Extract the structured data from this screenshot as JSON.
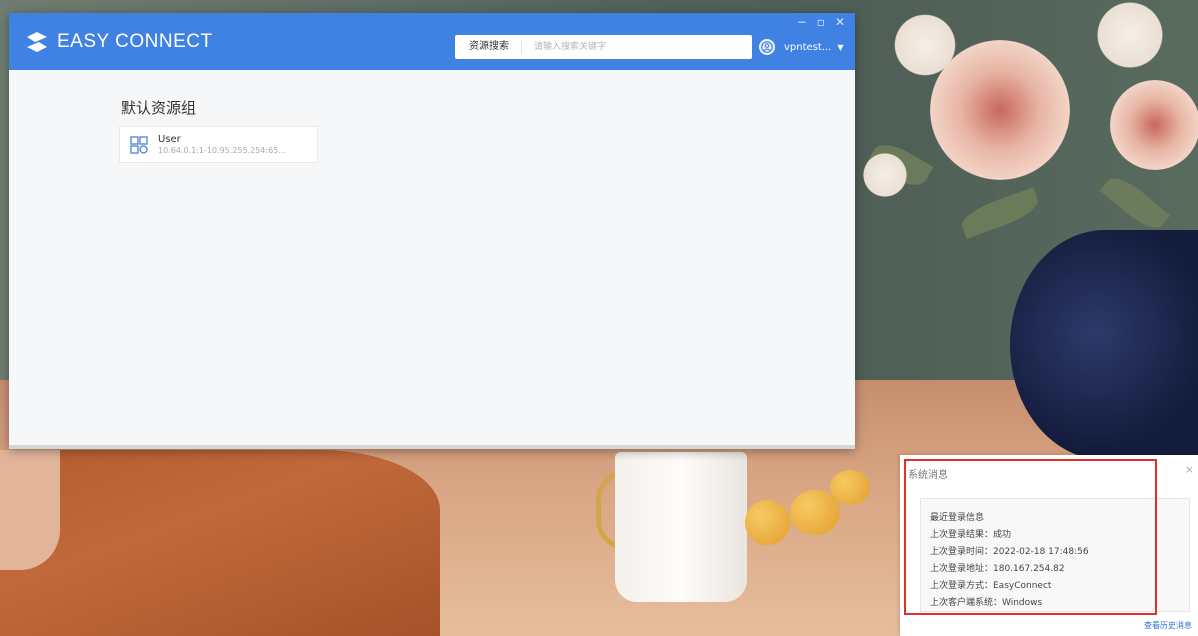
{
  "window": {
    "brand": "EASY CONNECT",
    "controls": {
      "minimize": "−",
      "maximize": "▫",
      "close": "✕"
    }
  },
  "header": {
    "search": {
      "tab_label": "资源搜索",
      "placeholder": "请输入搜索关键字",
      "value": ""
    },
    "user": {
      "name": "vpntest...",
      "caret": "▼"
    }
  },
  "main": {
    "group_title": "默认资源组",
    "resources": [
      {
        "name": "User",
        "range": "10.64.0.1:1-10.95.255.254:65..."
      }
    ]
  },
  "system_message": {
    "title": "系统消息",
    "close": "×",
    "lines": [
      "最近登录信息",
      "上次登录结果：成功",
      "上次登录时间：2022-02-18 17:48:56",
      "上次登录地址：180.167.254.82",
      "上次登录方式：EasyConnect",
      "上次客户端系统：Windows"
    ],
    "history_link": "查看历史消息"
  },
  "colors": {
    "titlebar": "#3f82e4",
    "highlight": "#e0302c",
    "link": "#2d6fd8"
  },
  "icons": {
    "logo": "easyconnect-logo-icon",
    "avatar": "user-avatar-icon",
    "resource": "app-grid-icon"
  }
}
